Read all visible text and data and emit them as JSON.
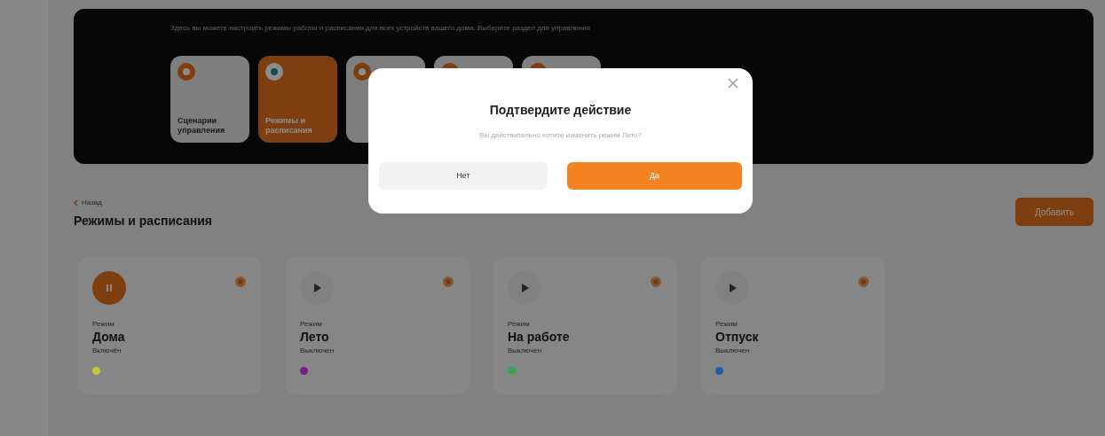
{
  "banner": {
    "text": "Здесь вы можете настроить режимы работы и расписания для всех устройств вашего дома. Выберите раздел для управления",
    "tiles": [
      {
        "label": "Сценарии управления",
        "selected": false
      },
      {
        "label": "Режимы и расписания",
        "selected": true
      },
      {
        "selected": false
      },
      {
        "selected": false
      },
      {
        "selected": false
      }
    ]
  },
  "header": {
    "back_link": "Назад",
    "title": "Режимы и расписания",
    "add_button": "Добавить"
  },
  "modes": [
    {
      "caption": "Режим",
      "name": "Дома",
      "status": "Включён",
      "active": true,
      "color": "#c9c43a"
    },
    {
      "caption": "Режим",
      "name": "Лето",
      "status": "Выключен",
      "active": false,
      "color": "#7a1b8c"
    },
    {
      "caption": "Режим",
      "name": "На работе",
      "status": "Выключен",
      "active": false,
      "color": "#3aa54c"
    },
    {
      "caption": "Режим",
      "name": "Отпуск",
      "status": "Выключен",
      "active": false,
      "color": "#1f5fa8"
    }
  ],
  "dialog": {
    "title": "Подтвердите действие",
    "message": "Вы действительно хотите изменить режим Лето?",
    "cancel": "Нет",
    "confirm": "Да"
  }
}
